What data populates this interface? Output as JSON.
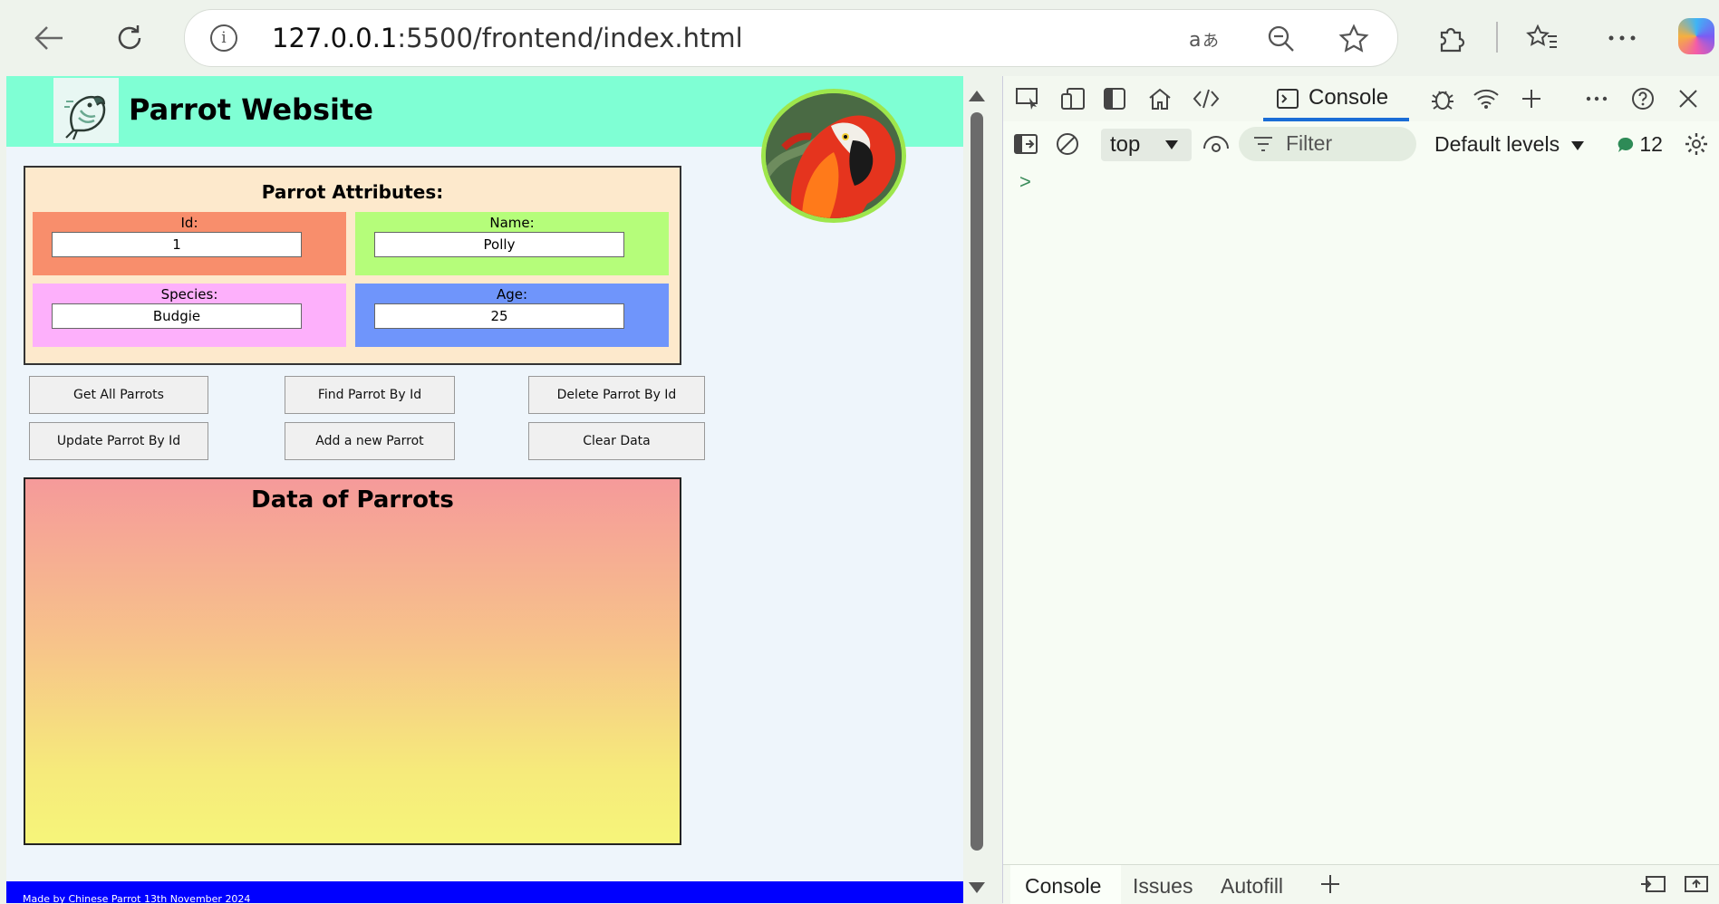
{
  "browser": {
    "url_host": "127.0.0.1",
    "url_path": ":5500/frontend/index.html",
    "info_glyph": "i",
    "icons": [
      "back-icon",
      "refresh-icon",
      "info-icon",
      "read-aloud-icon",
      "zoom-out-icon",
      "favorite-star-icon",
      "extensions-icon",
      "favorites-icon",
      "more-icon",
      "copilot-icon"
    ]
  },
  "site": {
    "title": "Parrot Website",
    "attributes_title": "Parrot Attributes:",
    "fields": {
      "id": {
        "label": "Id:",
        "value": "1"
      },
      "name": {
        "label": "Name:",
        "value": "Polly"
      },
      "species": {
        "label": "Species:",
        "value": "Budgie"
      },
      "age": {
        "label": "Age:",
        "value": "25"
      }
    },
    "buttons": {
      "get_all": "Get All Parrots",
      "find": "Find Parrot By Id",
      "delete": "Delete Parrot By Id",
      "update": "Update Parrot By Id",
      "add": "Add a new Parrot",
      "clear": "Clear Data"
    },
    "data_title": "Data of Parrots",
    "footer": "Made by Chinese Parrot 13th November 2024",
    "colors": {
      "header": "#7fffd4",
      "id_field": "#f88e6c",
      "name_field": "#b5fd7a",
      "species_field": "#fdb0fb",
      "age_field": "#6f95fb",
      "footer": "#0000ff"
    }
  },
  "devtools": {
    "active_tab": "Console",
    "context": "top",
    "filter_placeholder": "Filter",
    "levels": "Default levels",
    "message_count": "12",
    "prompt": ">",
    "drawer_tabs": [
      "Console",
      "Issues",
      "Autofill"
    ],
    "accent": "#1a6dd6"
  }
}
